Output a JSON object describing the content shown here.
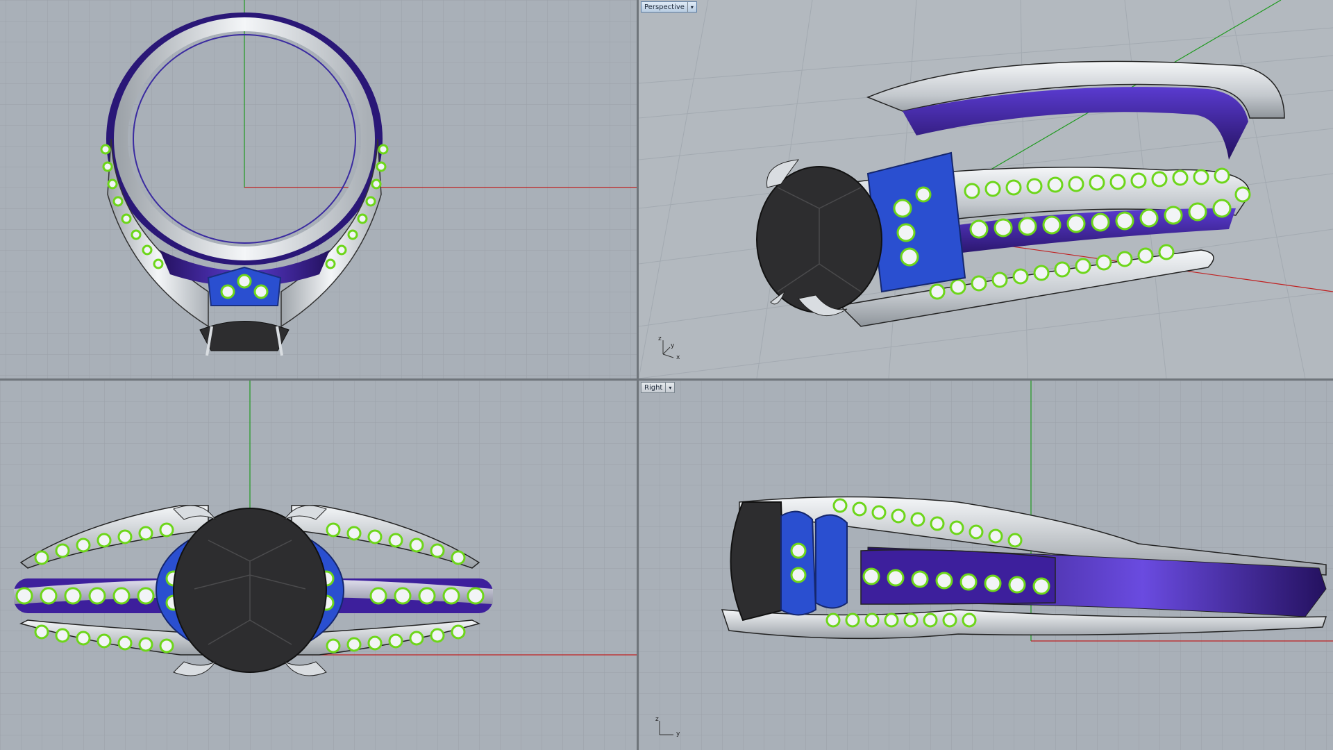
{
  "viewports": {
    "perspective": {
      "label": "Perspective",
      "active": true
    },
    "right": {
      "label": "Right"
    }
  },
  "axis_icon": {
    "z": "z",
    "y": "y",
    "x": "x"
  },
  "colors": {
    "viewport_bg": "#a9b0b8",
    "grid_minor": "#9da4ac",
    "grid_major": "#8f969e",
    "axis_x": "#c02020",
    "axis_y": "#1e9a1e",
    "metal": "#d9dde1",
    "band_inner": "#3d1f9c",
    "basket": "#2a4fd0",
    "center_stone": "#2d2d2f",
    "prong": "#6dd61a",
    "melee": "#f2f4f6"
  }
}
